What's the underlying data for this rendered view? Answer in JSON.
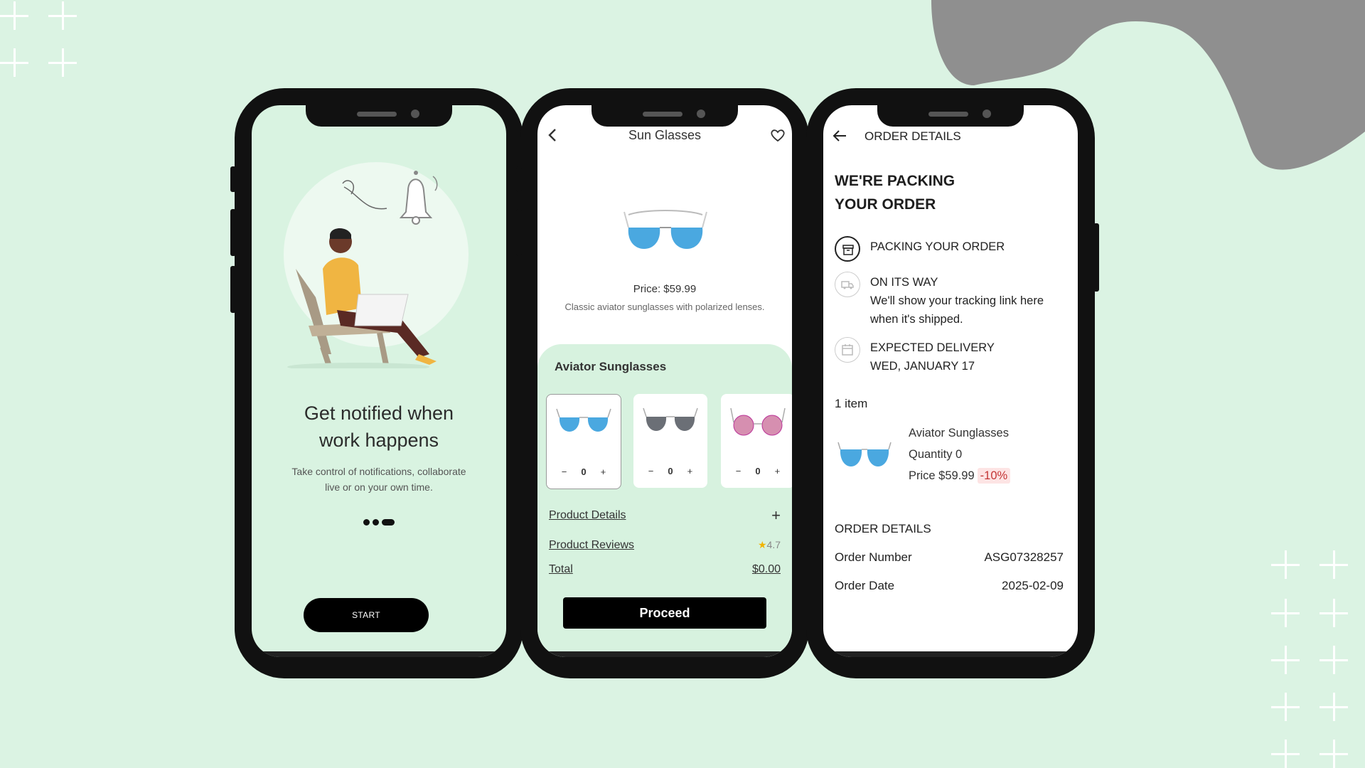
{
  "colors": {
    "background": "#dbf3e3",
    "blob": "#8f8f8f",
    "panel": "#d7f2df",
    "button": "#000000"
  },
  "screen1": {
    "title_line1": "Get notified when",
    "title_line2": "work happens",
    "subtitle_line1": "Take control of notifications, collaborate",
    "subtitle_line2": "live or on your own time.",
    "start_label": "START"
  },
  "screen2": {
    "title": "Sun Glasses",
    "price": "Price: $59.99",
    "description": "Classic aviator sunglasses with polarized lenses.",
    "section_title": "Aviator Sunglasses",
    "variants": [
      {
        "qty": "0",
        "color": "#4aa8e0"
      },
      {
        "qty": "0",
        "color": "#6b6f76"
      },
      {
        "qty": "0",
        "color": "#d68fb0"
      }
    ],
    "product_details": "Product Details",
    "product_reviews": "Product Reviews",
    "rating": "4.7",
    "total_label": "Total",
    "total_value": "$0.00",
    "proceed_label": "Proceed"
  },
  "screen3": {
    "header": "ORDER DETAILS",
    "heading_line1": "WE'RE PACKING",
    "heading_line2": "YOUR ORDER",
    "steps": [
      {
        "title": "PACKING YOUR ORDER",
        "detail1": "",
        "detail2": ""
      },
      {
        "title": "ON ITS WAY",
        "detail1": "We'll show your tracking link here",
        "detail2": "when it's shipped."
      },
      {
        "title": "EXPECTED DELIVERY",
        "detail1": "WED, JANUARY 17",
        "detail2": ""
      }
    ],
    "item_count": "1 item",
    "item_name": "Aviator Sunglasses",
    "item_qty": "Quantity 0",
    "item_price": "Price  $59.99",
    "item_discount": "-10%",
    "order_section": "ORDER DETAILS",
    "order_number_label": "Order Number",
    "order_number": "ASG07328257",
    "order_date_label": "Order Date",
    "order_date": "2025-02-09"
  }
}
